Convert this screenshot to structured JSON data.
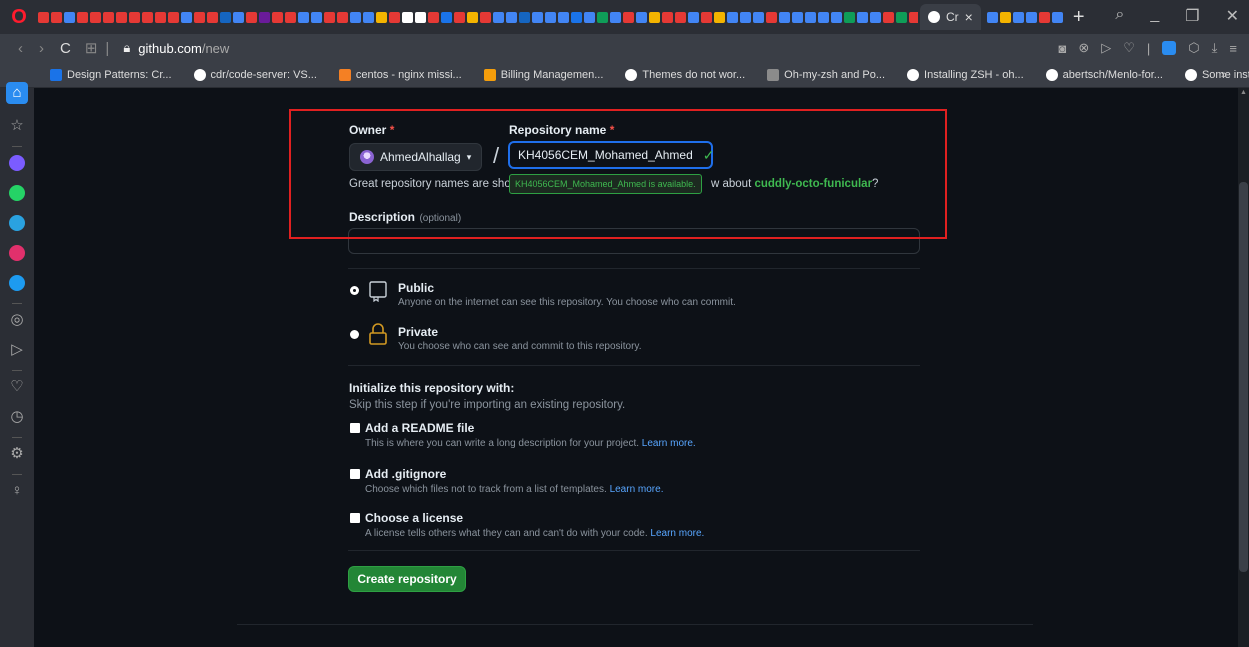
{
  "browser": {
    "active_tab_label": "Cr",
    "url_host": "github.com",
    "url_path": "/new",
    "bookmarks": [
      {
        "label": "Design Patterns: Cr...",
        "icon": "calendar-icon",
        "color": "#1a73e8"
      },
      {
        "label": "cdr/code-server: VS...",
        "icon": "github-icon",
        "color": "#ffffff"
      },
      {
        "label": "centos - nginx missi...",
        "icon": "stackoverflow-icon",
        "color": "#f48024"
      },
      {
        "label": "Billing Managemen...",
        "icon": "box-icon",
        "color": "#f59e0b"
      },
      {
        "label": "Themes do not wor...",
        "icon": "github-icon",
        "color": "#ffffff"
      },
      {
        "label": "Oh-my-zsh and Po...",
        "icon": "image-icon",
        "color": "#8b8b8b"
      },
      {
        "label": "Installing ZSH - oh...",
        "icon": "github-icon",
        "color": "#ffffff"
      },
      {
        "label": "abertsch/Menlo-for...",
        "icon": "github-icon",
        "color": "#ffffff"
      },
      {
        "label": "Some installed font...",
        "icon": "github-icon",
        "color": "#ffffff"
      }
    ],
    "bookmarks_overflow": "»"
  },
  "sidebar": {
    "icons": [
      {
        "name": "home-icon",
        "glyph": "⌂",
        "color": "#2a8cf0"
      },
      {
        "name": "star-icon",
        "glyph": "☆",
        "color": "#aaaaaa"
      },
      {
        "name": "messenger-icon",
        "glyph": "",
        "color": "#7b5cff"
      },
      {
        "name": "whatsapp-icon",
        "glyph": "",
        "color": "#25d366"
      },
      {
        "name": "telegram-icon",
        "glyph": "",
        "color": "#2aa2e0"
      },
      {
        "name": "instagram-icon",
        "glyph": "",
        "color": "#e1306c"
      },
      {
        "name": "twitter-icon",
        "glyph": "",
        "color": "#1d9bf0"
      },
      {
        "name": "player-icon",
        "glyph": "◎",
        "color": "#aaaaaa"
      },
      {
        "name": "flow-icon",
        "glyph": "▷",
        "color": "#aaaaaa"
      },
      {
        "name": "heart-icon",
        "glyph": "♡",
        "color": "#aaaaaa"
      },
      {
        "name": "history-icon",
        "glyph": "◷",
        "color": "#aaaaaa"
      },
      {
        "name": "settings-icon",
        "glyph": "⚙",
        "color": "#aaaaaa"
      },
      {
        "name": "tips-icon",
        "glyph": "♀",
        "color": "#aaaaaa"
      }
    ]
  },
  "form": {
    "owner_label": "Owner",
    "required_mark": "*",
    "owner_value": "AhmedAlhallag",
    "separator": "/",
    "repo_label": "Repository name",
    "repo_value": "KH4056CEM_Mohamed_Ahmed",
    "availability_tip": "KH4056CEM_Mohamed_Ahmed is available.",
    "hint_prefix": "Great repository names are shor",
    "hint_suffix": "w about",
    "suggestion": "cuddly-octo-funicular",
    "suggestion_end": "?",
    "description_label": "Description",
    "description_optional": "(optional)",
    "description_value": "",
    "visibility": [
      {
        "label": "Public",
        "desc": "Anyone on the internet can see this repository. You choose who can commit.",
        "selected": true
      },
      {
        "label": "Private",
        "desc": "You choose who can see and commit to this repository.",
        "selected": false
      }
    ],
    "init_title": "Initialize this repository with:",
    "init_subtitle": "Skip this step if you're importing an existing repository.",
    "options": [
      {
        "label": "Add a README file",
        "desc": "This is where you can write a long description for your project.",
        "link": "Learn more."
      },
      {
        "label": "Add .gitignore",
        "desc": "Choose which files not to track from a list of templates.",
        "link": "Learn more."
      },
      {
        "label": "Choose a license",
        "desc": "A license tells others what they can and can't do with your code.",
        "link": "Learn more."
      }
    ],
    "create_button": "Create repository"
  },
  "colors": {
    "highlight_box": "#e02020",
    "primary_button": "#238636",
    "success": "#3fb950",
    "link": "#58a6ff"
  }
}
